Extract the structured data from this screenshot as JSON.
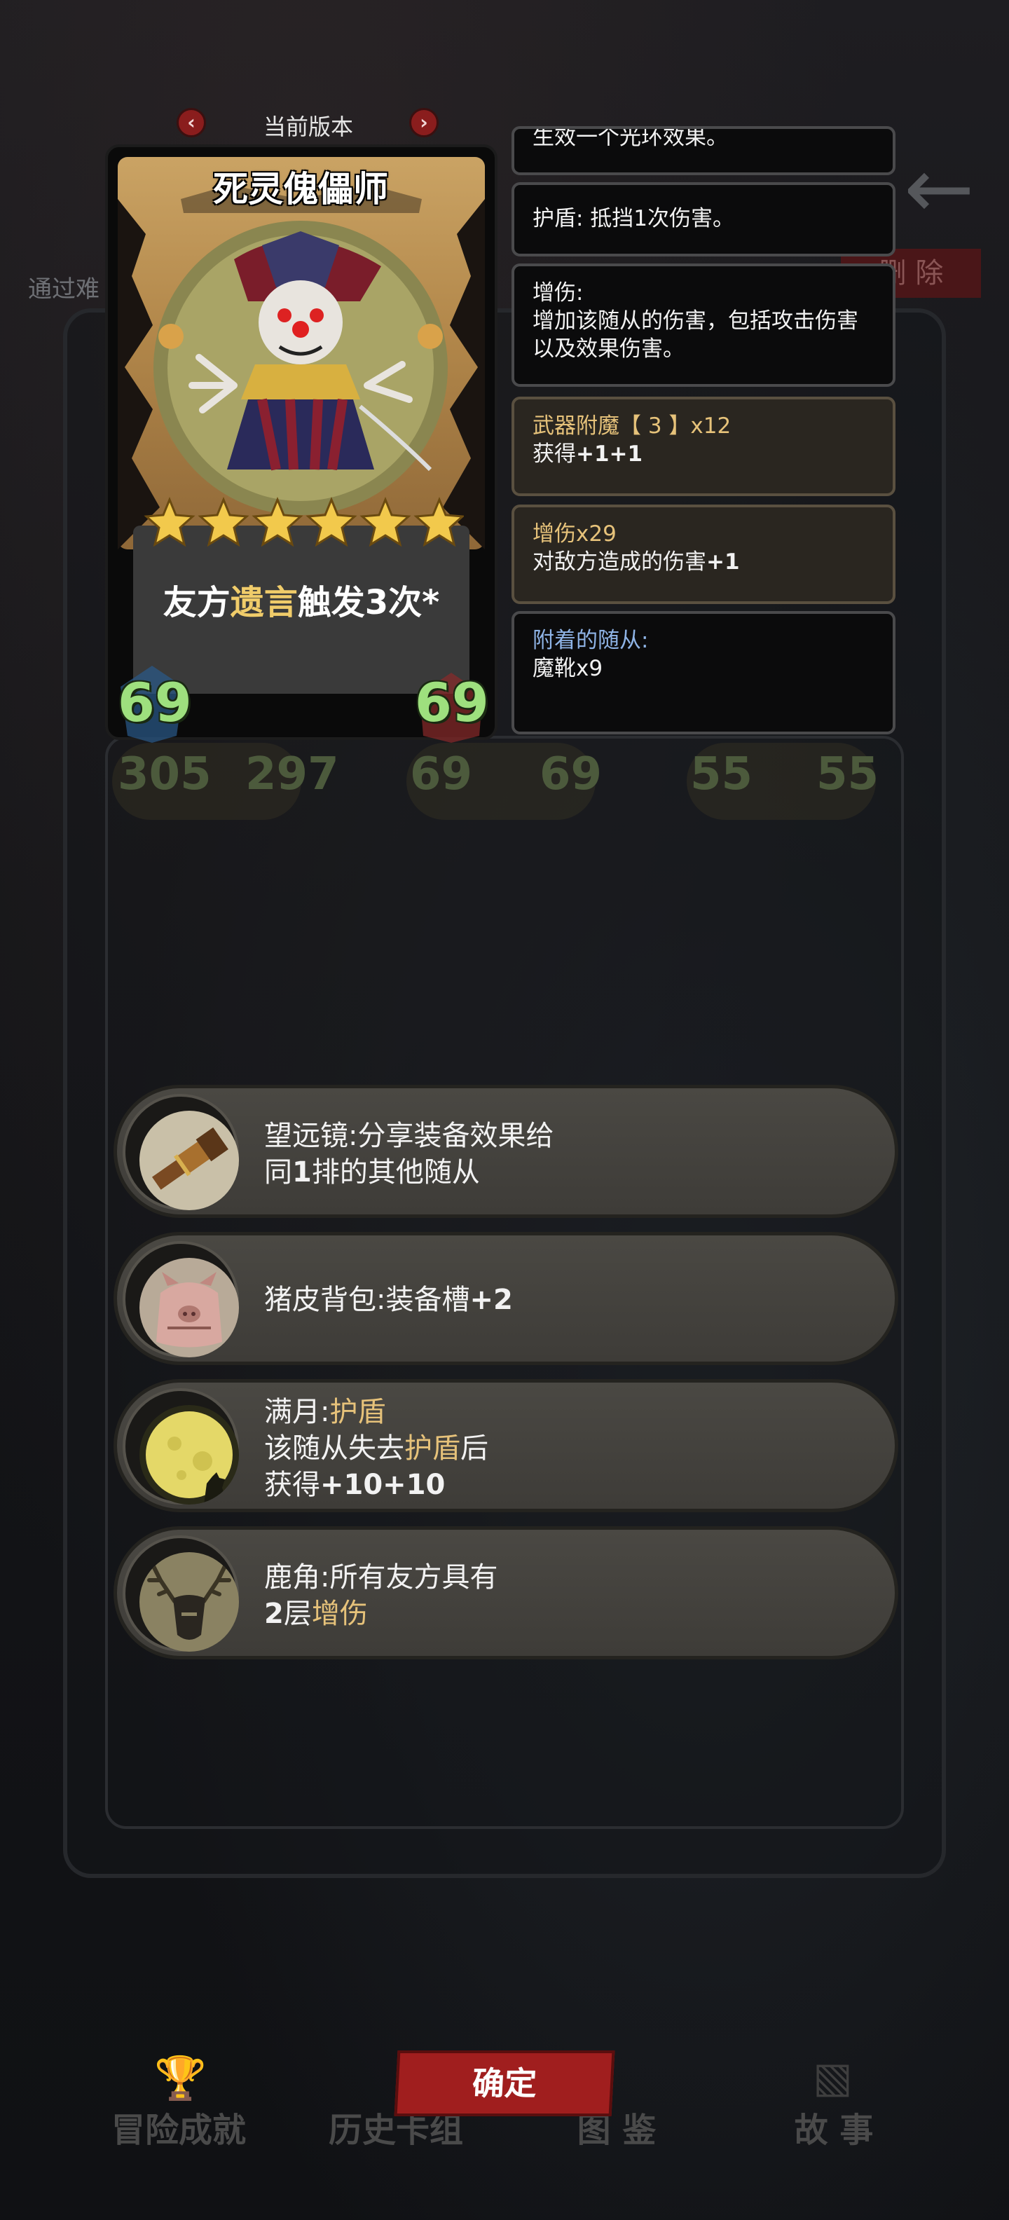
{
  "background": {
    "pass_label": "通过难",
    "delete_label": "删 除",
    "stats": [
      "305",
      "297",
      "69",
      "69",
      "55",
      "55"
    ]
  },
  "version_nav": {
    "label": "当前版本"
  },
  "card": {
    "name": "死灵傀儡师",
    "desc_prefix": "友方",
    "desc_highlight": "遗言",
    "desc_suffix": "触发3次*",
    "attack": "69",
    "health": "69",
    "stars": 6,
    "colors": {
      "frame": "#b2874a",
      "stat": "#9ee07e",
      "highlight": "#f0cc6a"
    }
  },
  "info_boxes": {
    "partial_top": "生效一个光环效果。",
    "shield": "护盾: 抵挡1次伤害。",
    "dmg_title": "增伤:",
    "dmg_desc": "增加该随从的伤害，包括攻击伤害以及效果伤害。",
    "weapon_title": "武器附魔【 3 】x12",
    "weapon_desc_prefix": "获得",
    "weapon_desc_value": "+1+1",
    "dmg29_title": "增伤x29",
    "dmg29_desc_prefix": "对敌方造成的伤害",
    "dmg29_desc_value": "+1",
    "attached_title": "附着的随从:",
    "attached_desc": "魔靴x9"
  },
  "equipment": [
    {
      "icon": "telescope-icon",
      "line1": "望远镜:分享装备效果给",
      "line2_prefix": "同",
      "line2_bold": "1",
      "line2_suffix": "排的其他随从"
    },
    {
      "icon": "pig-backpack-icon",
      "line1_prefix": "猪皮背包:装备槽",
      "line1_bold": "+2"
    },
    {
      "icon": "full-moon-icon",
      "line1_prefix": "满月:",
      "line1_hl": "护盾",
      "line2_prefix": "该随从失去",
      "line2_hl": "护盾",
      "line2_suffix": "后",
      "line3_prefix": "获得",
      "line3_bold": "+10+10"
    },
    {
      "icon": "antler-icon",
      "line1": "鹿角:所有友方具有",
      "line2_bold": "2",
      "line2_prefix": "层",
      "line2_hl": "增伤"
    }
  ],
  "bottom_nav": {
    "tabs": [
      "冒险成就",
      "历史卡组",
      "图 鉴",
      "故 事"
    ],
    "confirm": "确定"
  }
}
